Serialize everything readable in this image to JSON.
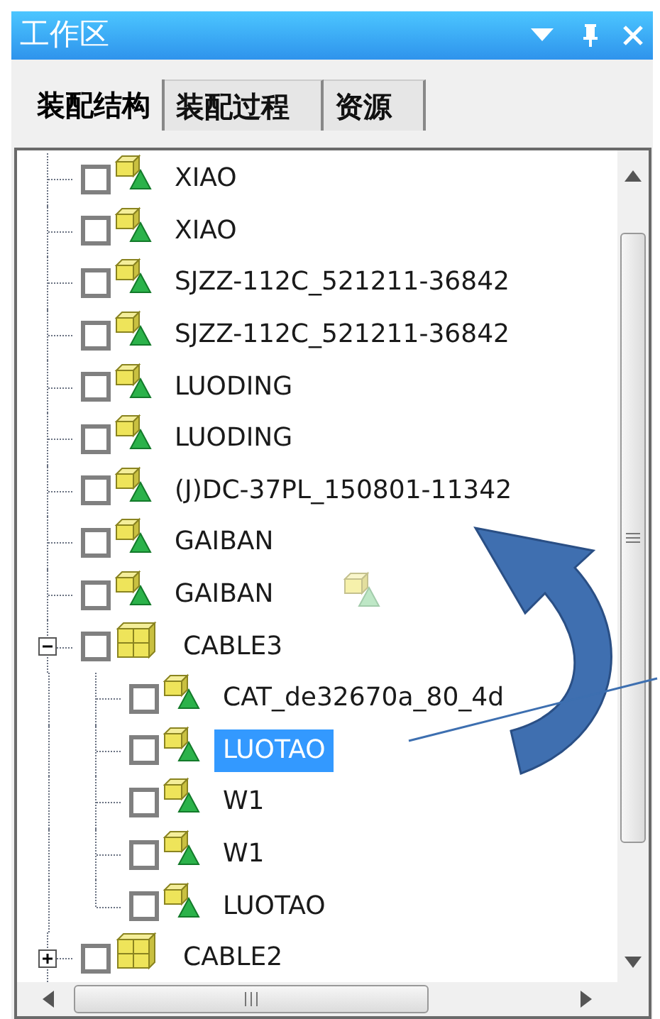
{
  "panel": {
    "title": "工作区"
  },
  "tabs": [
    {
      "label": "装配结构",
      "selected": true
    },
    {
      "label": "装配过程",
      "selected": false
    },
    {
      "label": "资源",
      "selected": false
    }
  ],
  "tree": {
    "items": [
      {
        "label": "XIAO",
        "kind": "part",
        "checked": false,
        "selected": false
      },
      {
        "label": "XIAO",
        "kind": "part",
        "checked": false,
        "selected": false
      },
      {
        "label": "SJZZ-112C_521211-36842",
        "kind": "part",
        "checked": false,
        "selected": false
      },
      {
        "label": "SJZZ-112C_521211-36842",
        "kind": "part",
        "checked": false,
        "selected": false
      },
      {
        "label": "LUODING",
        "kind": "part",
        "checked": false,
        "selected": false
      },
      {
        "label": "LUODING",
        "kind": "part",
        "checked": false,
        "selected": false
      },
      {
        "label": "(J)DC-37PL_150801-11342",
        "kind": "part",
        "checked": false,
        "selected": false
      },
      {
        "label": "GAIBAN",
        "kind": "part",
        "checked": false,
        "selected": false
      },
      {
        "label": "GAIBAN",
        "kind": "part",
        "checked": false,
        "selected": false
      },
      {
        "label": "CABLE3",
        "kind": "assembly",
        "checked": false,
        "selected": false,
        "expanded": true,
        "children": [
          {
            "label": "CAT_de32670a_80_4d",
            "kind": "part",
            "checked": false,
            "selected": false
          },
          {
            "label": "LUOTAO",
            "kind": "part",
            "checked": false,
            "selected": true
          },
          {
            "label": "W1",
            "kind": "part",
            "checked": false,
            "selected": false
          },
          {
            "label": "W1",
            "kind": "part",
            "checked": false,
            "selected": false
          },
          {
            "label": "LUOTAO",
            "kind": "part",
            "checked": false,
            "selected": false
          }
        ]
      },
      {
        "label": "CABLE2",
        "kind": "assembly",
        "checked": false,
        "selected": false,
        "expanded": false
      }
    ]
  }
}
